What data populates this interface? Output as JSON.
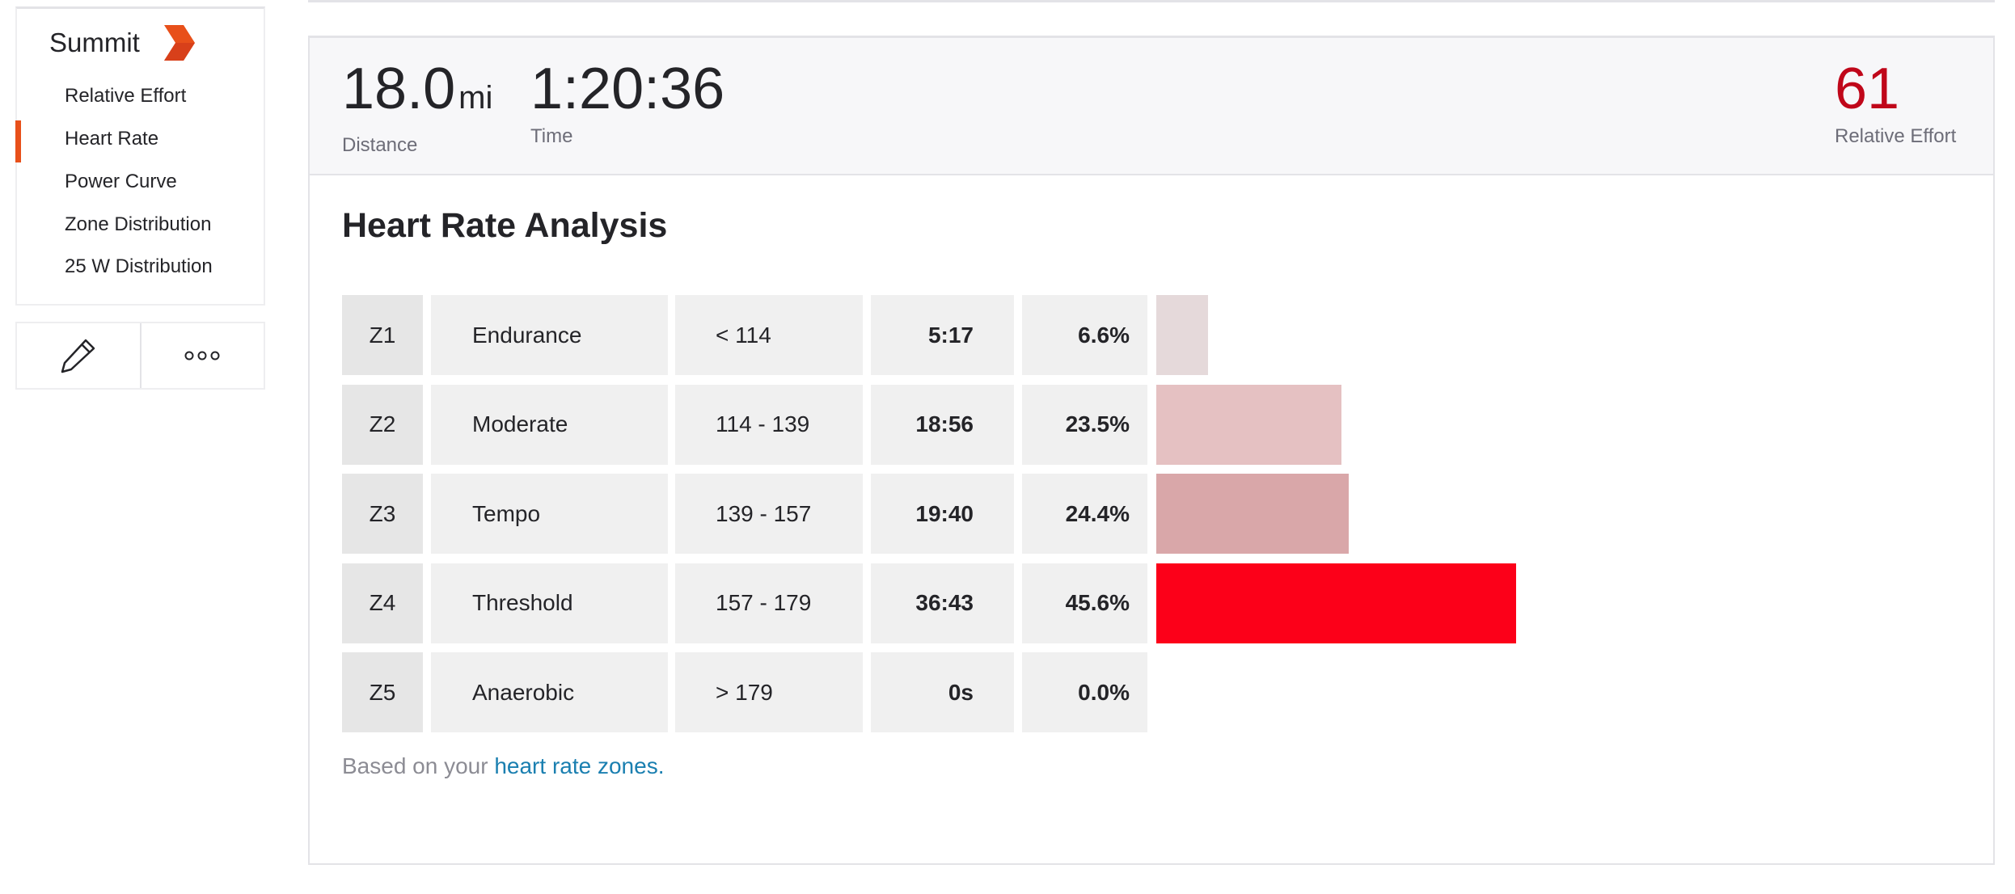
{
  "sidebar": {
    "title": "Summit",
    "title_icon": "summit-chevron-icon",
    "items": [
      {
        "label": "Relative Effort",
        "active": false
      },
      {
        "label": "Heart Rate",
        "active": true
      },
      {
        "label": "Power Curve",
        "active": false
      },
      {
        "label": "Zone Distribution",
        "active": false
      },
      {
        "label": "25 W Distribution",
        "active": false
      }
    ],
    "actions": [
      {
        "name": "edit",
        "icon": "pencil-icon"
      },
      {
        "name": "more",
        "icon": "ellipsis-icon"
      }
    ]
  },
  "stats": {
    "distance": {
      "value": "18.0",
      "unit": "mi",
      "label": "Distance"
    },
    "time": {
      "value": "1:20:36",
      "label": "Time"
    },
    "relative_effort": {
      "value": "61",
      "label": "Relative Effort"
    }
  },
  "analysis": {
    "title": "Heart Rate Analysis",
    "footnote_prefix": "Based on your ",
    "footnote_link": "heart rate zones."
  },
  "chart_data": {
    "type": "bar",
    "title": "Heart Rate Analysis",
    "orientation": "horizontal",
    "categories": [
      "Z1",
      "Z2",
      "Z3",
      "Z4",
      "Z5"
    ],
    "zone_names": [
      "Endurance",
      "Moderate",
      "Tempo",
      "Threshold",
      "Anaerobic"
    ],
    "ranges": [
      "< 114",
      "114 - 139",
      "139 - 157",
      "157 - 179",
      "> 179"
    ],
    "times": [
      "5:17",
      "18:56",
      "19:40",
      "36:43",
      "0s"
    ],
    "percent_labels": [
      "6.6%",
      "23.5%",
      "24.4%",
      "45.6%",
      "0.0%"
    ],
    "values": [
      6.6,
      23.5,
      24.4,
      45.6,
      0.0
    ],
    "bar_colors": [
      "#e5d9da",
      "#e5c1c2",
      "#d9a7a9",
      "#fc0019",
      "#fc0019"
    ],
    "xlabel": "",
    "ylabel": ""
  },
  "colors": {
    "accent": "#e8501a",
    "effort": "#c0071a",
    "link": "#1a7fb0"
  }
}
